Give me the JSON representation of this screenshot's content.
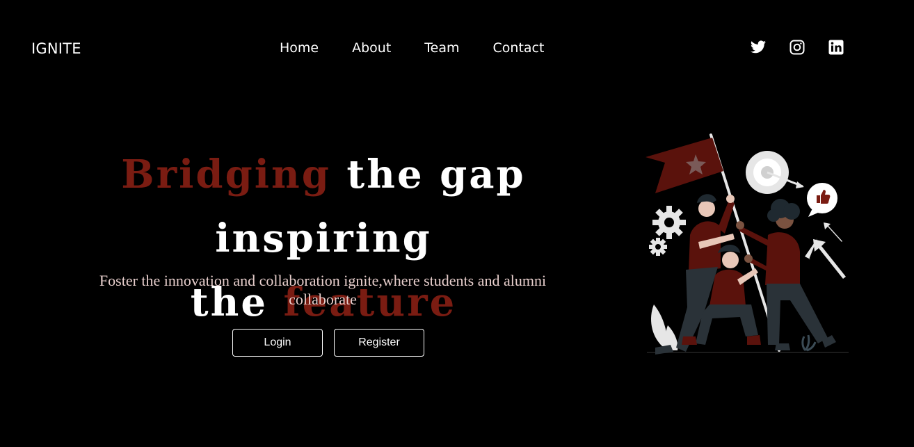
{
  "header": {
    "brand": "IGNITE",
    "nav": [
      {
        "label": "Home"
      },
      {
        "label": "About"
      },
      {
        "label": "Team"
      },
      {
        "label": "Contact"
      }
    ],
    "social": [
      "twitter-icon",
      "instagram-icon",
      "linkedin-icon"
    ]
  },
  "hero": {
    "title_part1": "Bridging",
    "title_part2": " the gap inspiring",
    "title_part3": "the ",
    "title_part4": "feature",
    "subtitle": "Foster the innovation and collaboration ignite,where students and alumni collaborate",
    "login_label": "Login",
    "register_label": "Register"
  },
  "colors": {
    "background": "#000000",
    "accent": "#7a1c12",
    "subtitle": "#e8cfcd",
    "text": "#ffffff"
  }
}
